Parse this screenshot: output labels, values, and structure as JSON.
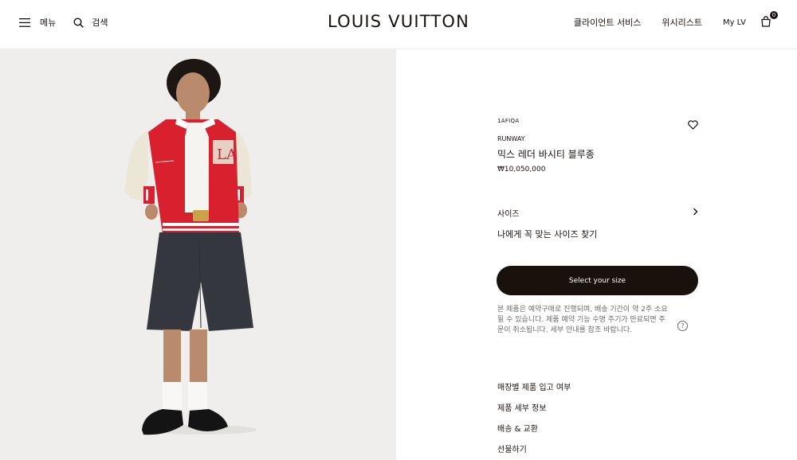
{
  "header": {
    "menu_label": "메뉴",
    "search_label": "검색",
    "logo": "LOUIS VUITTON",
    "client_services": "클라이언트 서비스",
    "wishlist": "위시리스트",
    "my_lv": "My LV",
    "bag_count": "0"
  },
  "product": {
    "sku": "1AFIQA",
    "collection": "RUNWAY",
    "name": "믹스 레더 바시티 블루종",
    "price": "₩10,050,000",
    "size_label": "사이즈",
    "find_size": "나에게 꼭 맞는 사이즈 찾기",
    "cta_label": "Select your size",
    "notice": "본 제품은 예약구매로 진행되며, 배송 기간이 약 2주 소요될 수 있습니다. 제품 예약 기능 수명 주기가 만료되면 주문이 취소됩니다. 세부 안내를 참조 바랍니다.",
    "help_glyph": "?"
  },
  "links": [
    {
      "label": "매장별 제품 입고 여부"
    },
    {
      "label": "제품 세부 정보"
    },
    {
      "label": "배송 & 교환"
    },
    {
      "label": "선물하기"
    }
  ],
  "colors": {
    "text": "#19110b",
    "image_bg": "#efeeec",
    "jacket_red": "#d8202f",
    "sleeve_cream": "#ece6d7",
    "shorts": "#34383e"
  },
  "icons": [
    "hamburger-icon",
    "search-icon",
    "bag-icon",
    "heart-icon",
    "chevron-right-icon",
    "help-icon"
  ]
}
